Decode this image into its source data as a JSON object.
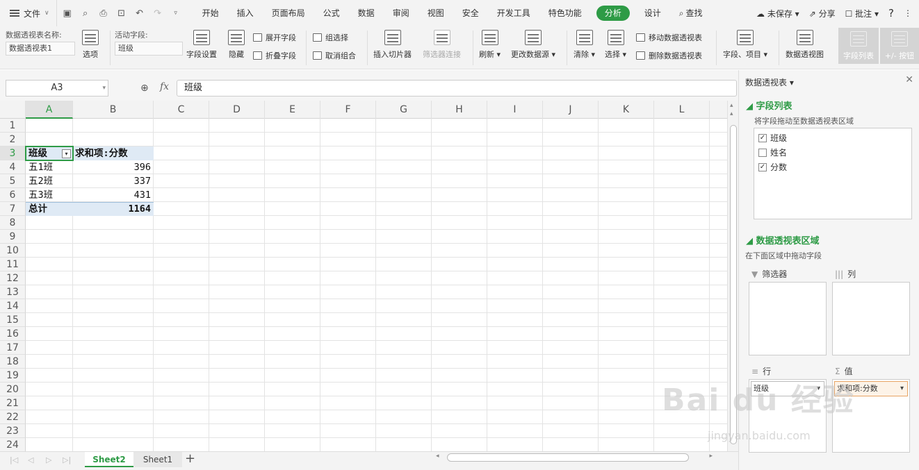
{
  "menubar": {
    "file_label": "文件",
    "tabs": [
      "开始",
      "插入",
      "页面布局",
      "公式",
      "数据",
      "审阅",
      "视图",
      "安全",
      "开发工具",
      "特色功能",
      "分析",
      "设计"
    ],
    "active_tab": "分析",
    "find_label": "查找",
    "unsaved_label": "未保存",
    "share_label": "分享",
    "comment_label": "批注",
    "help_label": "?"
  },
  "ribbon": {
    "pivot_name_label": "数据透视表名称:",
    "pivot_name_value": "数据透视表1",
    "options_label": "选项",
    "active_field_label": "活动字段:",
    "active_field_value": "班级",
    "field_settings": "字段设置",
    "hide": "隐藏",
    "expand_field": "展开字段",
    "collapse_field": "折叠字段",
    "group_selection": "组选择",
    "ungroup": "取消组合",
    "insert_slicer": "插入切片器",
    "filter_connections": "筛选器连接",
    "refresh": "刷新",
    "change_source": "更改数据源",
    "clear": "清除",
    "select": "选择",
    "move_pivot": "移动数据透视表",
    "delete_pivot": "删除数据透视表",
    "fields_items": "字段、项目",
    "pivot_chart": "数据透视图",
    "field_list": "字段列表",
    "buttons": "+/- 按钮"
  },
  "formula_bar": {
    "name_box": "A3",
    "fx": "fx",
    "content": "班级"
  },
  "grid": {
    "columns": [
      "A",
      "B",
      "C",
      "D",
      "E",
      "F",
      "G",
      "H",
      "I",
      "J",
      "K",
      "L"
    ],
    "rows": [
      "1",
      "2",
      "3",
      "4",
      "5",
      "6",
      "7",
      "8",
      "9",
      "10",
      "11",
      "12",
      "13",
      "14",
      "15",
      "16",
      "17",
      "18",
      "19",
      "20",
      "21",
      "22",
      "23",
      "24"
    ],
    "pivot": {
      "header_row_label": "班级",
      "header_value_label": "求和项:分数",
      "rows": [
        {
          "label": "五1班",
          "value": "396"
        },
        {
          "label": "五2班",
          "value": "337"
        },
        {
          "label": "五3班",
          "value": "431"
        }
      ],
      "total_label": "总计",
      "total_value": "1164"
    }
  },
  "sheets": {
    "tabs": [
      "Sheet2",
      "Sheet1"
    ],
    "active": "Sheet2",
    "add": "+"
  },
  "panel": {
    "title": "数据透视表",
    "field_list_heading": "字段列表",
    "field_list_sub": "将字段拖动至数据透视表区域",
    "fields": [
      {
        "name": "班级",
        "checked": true
      },
      {
        "name": "姓名",
        "checked": false
      },
      {
        "name": "分数",
        "checked": true
      }
    ],
    "area_heading": "数据透视表区域",
    "area_sub": "在下面区域中拖动字段",
    "filters_label": "筛选器",
    "columns_label": "列",
    "rows_label": "行",
    "values_label": "值",
    "row_field": "班级",
    "value_field": "求和项:分数"
  },
  "watermark": {
    "text": "Bai du 经验",
    "sub": "jingyan.baidu.com"
  },
  "colors": {
    "accent": "#2e9b46",
    "pivot_header_bg": "#dfeaf5"
  }
}
